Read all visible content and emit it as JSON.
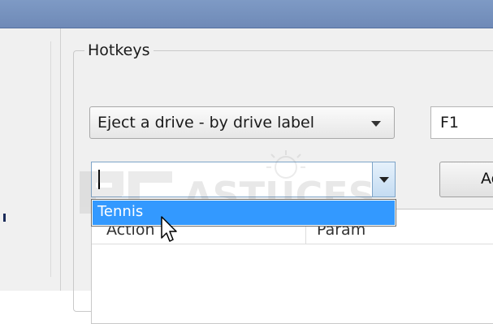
{
  "group": {
    "title": "Hotkeys"
  },
  "action_combo": {
    "selected": "Eject a drive - by drive label"
  },
  "hotkey_field": {
    "value": "F1"
  },
  "param_combo": {
    "value": "",
    "options": [
      "Tennis"
    ]
  },
  "add_button": {
    "label": "Ac"
  },
  "list": {
    "columns": [
      "Action",
      "Param"
    ]
  },
  "watermark": {
    "text": "ASTUCES"
  },
  "colors": {
    "selection": "#3399ff",
    "titlebar": "#7e9ac5",
    "window_bg": "#f0f0f0"
  }
}
